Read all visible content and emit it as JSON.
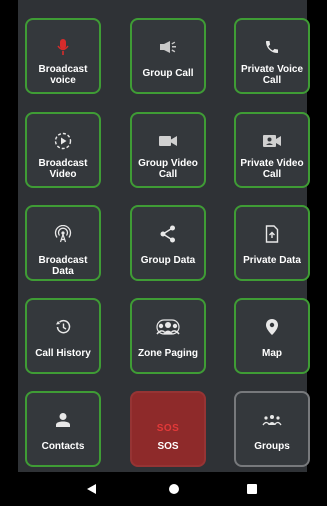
{
  "tiles": [
    {
      "label": "Broadcast voice",
      "icon": "microphone-icon"
    },
    {
      "label": "Group Call",
      "icon": "megaphone-icon"
    },
    {
      "label": "Private Voice Call",
      "icon": "phone-icon"
    },
    {
      "label": "Broadcast Video",
      "icon": "play-circle-icon"
    },
    {
      "label": "Group Video Call",
      "icon": "video-camera-icon"
    },
    {
      "label": "Private Video Call",
      "icon": "video-person-icon"
    },
    {
      "label": "Broadcast Data",
      "icon": "broadcast-tower-icon"
    },
    {
      "label": "Group Data",
      "icon": "share-icon"
    },
    {
      "label": "Private Data",
      "icon": "upload-file-icon"
    },
    {
      "label": "Call History",
      "icon": "history-icon"
    },
    {
      "label": "Zone Paging",
      "icon": "group-people-icon"
    },
    {
      "label": "Map",
      "icon": "location-pin-icon"
    },
    {
      "label": "Contacts",
      "icon": "person-icon"
    },
    {
      "label": "SOS",
      "icon_text": "SOS"
    },
    {
      "label": "Groups",
      "icon": "groups-icon"
    }
  ],
  "colors": {
    "tile_border": "#3f9c35",
    "sos_background": "#8e2a2a",
    "microphone": "#d92b2b"
  }
}
